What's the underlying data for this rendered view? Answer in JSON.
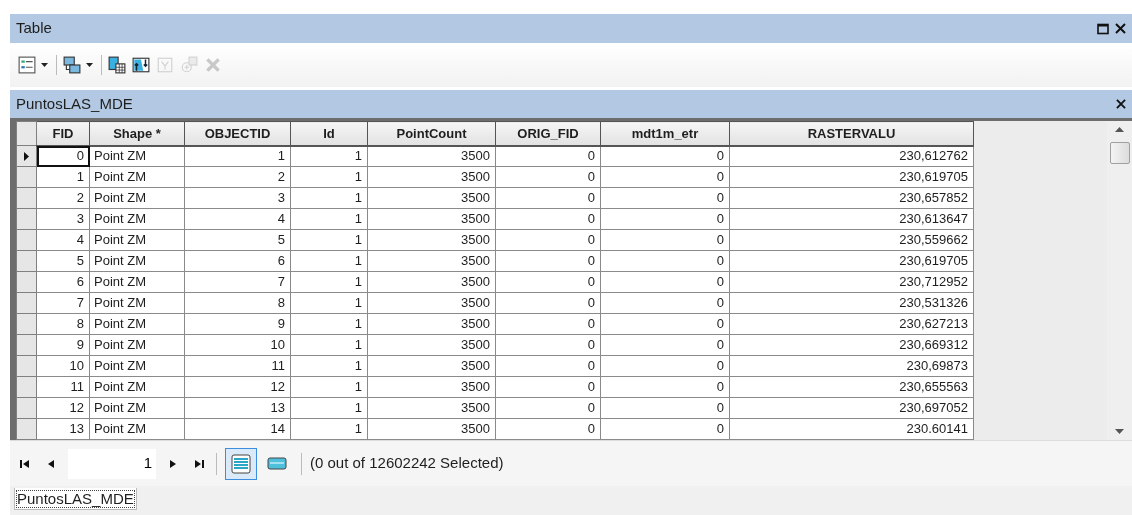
{
  "window": {
    "title": "Table"
  },
  "toolbar": [
    {
      "kind": "table-options",
      "dropdown": true,
      "disabled": false
    },
    {
      "kind": "related-tables",
      "dropdown": true,
      "disabled": false
    },
    {
      "kind": "select-by-attributes",
      "dropdown": false,
      "disabled": false
    },
    {
      "kind": "switch-selection",
      "dropdown": false,
      "disabled": false
    },
    {
      "kind": "clear-selection",
      "dropdown": false,
      "disabled": true
    },
    {
      "kind": "zoom-to-selected",
      "dropdown": false,
      "disabled": true
    },
    {
      "kind": "delete",
      "dropdown": false,
      "disabled": true
    }
  ],
  "layer": {
    "title": "PuntosLAS_MDE"
  },
  "table": {
    "columns": [
      "FID",
      "Shape *",
      "OBJECTID",
      "Id",
      "PointCount",
      "ORIG_FID",
      "mdt1m_etr",
      "RASTERVALU"
    ],
    "rows": [
      {
        "current": true,
        "cells": [
          "0",
          "Point ZM",
          "1",
          "1",
          "3500",
          "0",
          "0",
          "230,612762"
        ]
      },
      {
        "current": false,
        "cells": [
          "1",
          "Point ZM",
          "2",
          "1",
          "3500",
          "0",
          "0",
          "230,619705"
        ]
      },
      {
        "current": false,
        "cells": [
          "2",
          "Point ZM",
          "3",
          "1",
          "3500",
          "0",
          "0",
          "230,657852"
        ]
      },
      {
        "current": false,
        "cells": [
          "3",
          "Point ZM",
          "4",
          "1",
          "3500",
          "0",
          "0",
          "230,613647"
        ]
      },
      {
        "current": false,
        "cells": [
          "4",
          "Point ZM",
          "5",
          "1",
          "3500",
          "0",
          "0",
          "230,559662"
        ]
      },
      {
        "current": false,
        "cells": [
          "5",
          "Point ZM",
          "6",
          "1",
          "3500",
          "0",
          "0",
          "230,619705"
        ]
      },
      {
        "current": false,
        "cells": [
          "6",
          "Point ZM",
          "7",
          "1",
          "3500",
          "0",
          "0",
          "230,712952"
        ]
      },
      {
        "current": false,
        "cells": [
          "7",
          "Point ZM",
          "8",
          "1",
          "3500",
          "0",
          "0",
          "230,531326"
        ]
      },
      {
        "current": false,
        "cells": [
          "8",
          "Point ZM",
          "9",
          "1",
          "3500",
          "0",
          "0",
          "230,627213"
        ]
      },
      {
        "current": false,
        "cells": [
          "9",
          "Point ZM",
          "10",
          "1",
          "3500",
          "0",
          "0",
          "230,669312"
        ]
      },
      {
        "current": false,
        "cells": [
          "10",
          "Point ZM",
          "11",
          "1",
          "3500",
          "0",
          "0",
          "230,69873"
        ]
      },
      {
        "current": false,
        "cells": [
          "11",
          "Point ZM",
          "12",
          "1",
          "3500",
          "0",
          "0",
          "230,655563"
        ]
      },
      {
        "current": false,
        "cells": [
          "12",
          "Point ZM",
          "13",
          "1",
          "3500",
          "0",
          "0",
          "230,697052"
        ]
      },
      {
        "current": false,
        "cells": [
          "13",
          "Point ZM",
          "14",
          "1",
          "3500",
          "0",
          "0",
          "230.60141"
        ]
      }
    ]
  },
  "footer": {
    "record": "1",
    "views": [
      {
        "kind": "all",
        "selected": true
      },
      {
        "kind": "selected",
        "selected": false
      }
    ],
    "status": "(0 out of 12602242 Selected)"
  },
  "tabs": [
    {
      "label": "PuntosLAS_MDE",
      "selected": true
    }
  ]
}
